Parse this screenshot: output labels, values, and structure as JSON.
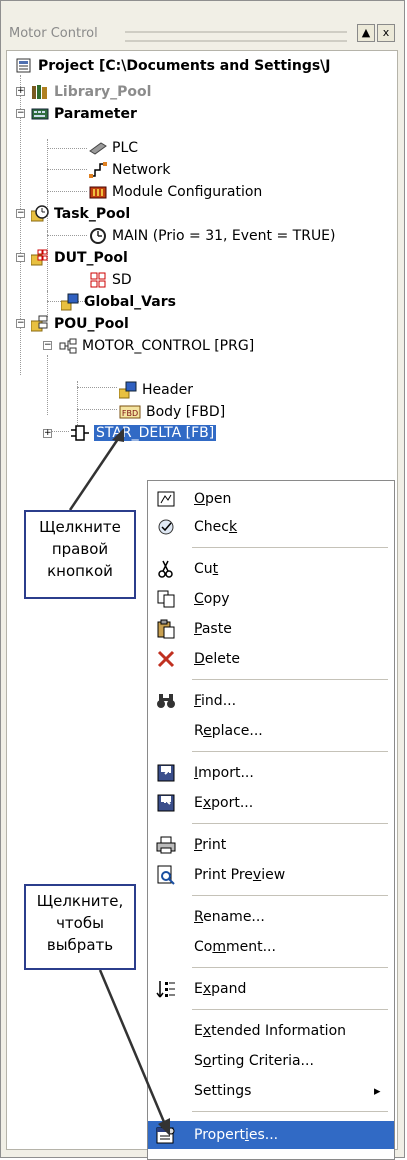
{
  "window": {
    "title": "Motor Control",
    "pin_button": "▲",
    "close_button": "x"
  },
  "tree": {
    "project": "Project [C:\\Documents and Settings\\J",
    "library_pool": "Library_Pool",
    "parameter": "Parameter",
    "plc": "PLC",
    "network": "Network",
    "module_configuration": "Module Configuration",
    "task_pool": "Task_Pool",
    "main_task": "MAIN (Prio = 31, Event = TRUE)",
    "dut_pool": "DUT_Pool",
    "sd": "SD",
    "global_vars": "Global_Vars",
    "pou_pool": "POU_Pool",
    "motor_control": "MOTOR_CONTROL [PRG]",
    "header": "Header",
    "body": "Body [FBD]",
    "star_delta": "STAR_DELTA [FB]",
    "fbd_icon_text": "FBD"
  },
  "context_menu": {
    "items": [
      {
        "pre": "",
        "ul": "O",
        "post": "pen"
      },
      {
        "pre": "Chec",
        "ul": "k",
        "post": ""
      },
      {
        "pre": "Cu",
        "ul": "t",
        "post": ""
      },
      {
        "pre": "",
        "ul": "C",
        "post": "opy"
      },
      {
        "pre": "",
        "ul": "P",
        "post": "aste"
      },
      {
        "pre": "",
        "ul": "D",
        "post": "elete"
      },
      {
        "pre": "",
        "ul": "F",
        "post": "ind..."
      },
      {
        "pre": "R",
        "ul": "e",
        "post": "place..."
      },
      {
        "pre": "",
        "ul": "I",
        "post": "mport..."
      },
      {
        "pre": "E",
        "ul": "x",
        "post": "port..."
      },
      {
        "pre": "",
        "ul": "P",
        "post": "rint"
      },
      {
        "pre": "Print Pre",
        "ul": "v",
        "post": "iew"
      },
      {
        "pre": "",
        "ul": "R",
        "post": "ename..."
      },
      {
        "pre": "Co",
        "ul": "m",
        "post": "ment..."
      },
      {
        "pre": "E",
        "ul": "x",
        "post": "pand"
      },
      {
        "pre": "E",
        "ul": "x",
        "post": "tended Information"
      },
      {
        "pre": "S",
        "ul": "o",
        "post": "rting Criteria..."
      },
      {
        "pre": "Settings",
        "ul": "",
        "post": ""
      },
      {
        "pre": "Propert",
        "ul": "i",
        "post": "es..."
      }
    ],
    "submenu_arrow": "▸"
  },
  "callouts": {
    "right_click": [
      "Щелкните",
      "правой",
      "кнопкой"
    ],
    "click_select": [
      "Щелкните,",
      "чтобы",
      "выбрать"
    ]
  },
  "colors": {
    "selection": "#316ac5",
    "callout_border": "#2b3d8c",
    "panel_bg": "#f1efe6"
  }
}
